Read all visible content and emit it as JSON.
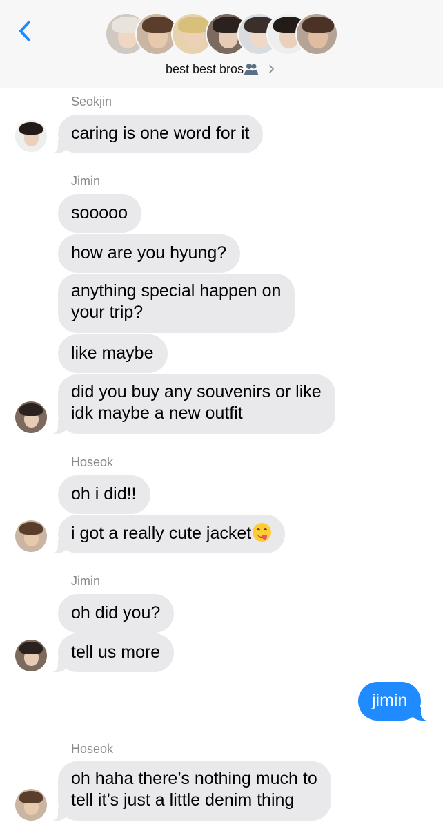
{
  "header": {
    "group_name": "best best bros",
    "back_icon": "chevron-left-icon",
    "group_icon": "people-icon",
    "chevron_icon": "chevron-right-icon",
    "accent_color": "#1f8bff",
    "member_avatars": [
      {
        "hair": "#e8e4dc",
        "face": "#efd7c4",
        "bg": "#cfc9c1"
      },
      {
        "hair": "#5a3d2b",
        "face": "#e7c9ae",
        "bg": "#c9b5a2"
      },
      {
        "hair": "#d9c07a",
        "face": "#edd1b6",
        "bg": "#e6d3ad"
      },
      {
        "hair": "#2b2220",
        "face": "#e6cbb6",
        "bg": "#7d6a5e"
      },
      {
        "hair": "#3a2f2a",
        "face": "#eed8c8",
        "bg": "#d9dcdf"
      },
      {
        "hair": "#231b18",
        "face": "#ead0bd",
        "bg": "#eeeeee"
      },
      {
        "hair": "#4a3326",
        "face": "#e0bd9f",
        "bg": "#b5a395"
      }
    ]
  },
  "messages": {
    "seokjin_name": "Seokjin",
    "seokjin_1": "caring is one word for it",
    "jimin_name_1": "Jimin",
    "jimin_1": "sooooo",
    "jimin_2": "how are you hyung?",
    "jimin_3a": "anything special happen on",
    "jimin_3b": "your trip?",
    "jimin_4": "like maybe",
    "jimin_5a": "did you buy any souvenirs or like",
    "jimin_5b": "idk maybe a new outfit",
    "hoseok_name_1": "Hoseok",
    "hoseok_1": "oh i did!!",
    "hoseok_2": "i got a really cute jacket",
    "hoseok_2_emoji": "face-savoring-food-emoji",
    "jimin_name_2": "Jimin",
    "jimin_6": "oh did you?",
    "jimin_7": "tell us more",
    "me_1": "jimin",
    "hoseok_name_2": "Hoseok",
    "hoseok_3a": "oh haha there’s nothing much to",
    "hoseok_3b": "tell it’s just a little denim thing"
  },
  "colors": {
    "incoming_bubble": "#e9e9eb",
    "outgoing_bubble": "#1f8bff",
    "sender_label": "#8a8a8e"
  }
}
